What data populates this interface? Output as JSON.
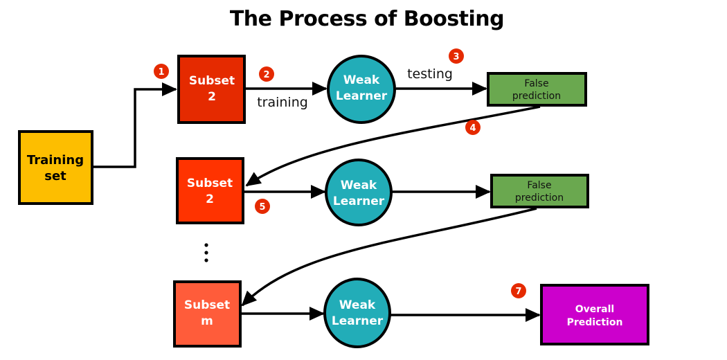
{
  "title": "The Process of Boosting",
  "colors": {
    "training_set": "#FDBE00",
    "subset_1": "#E52A00",
    "subset_2": "#FF3300",
    "subset_m": "#FF5C3A",
    "weak_learner": "#22ADB8",
    "false_prediction": "#6AA84F",
    "overall_prediction": "#CC00CC",
    "badge": "#E52A00",
    "stroke": "#000000"
  },
  "nodes": {
    "training_set": {
      "line1": "Training",
      "line2": "set"
    },
    "subset_1": {
      "line1": "Subset",
      "line2": "2"
    },
    "subset_2": {
      "line1": "Subset",
      "line2": "2"
    },
    "subset_m": {
      "line1": "Subset",
      "line2": "m"
    },
    "weak_learner_1": {
      "line1": "Weak",
      "line2": "Learner"
    },
    "weak_learner_2": {
      "line1": "Weak",
      "line2": "Learner"
    },
    "weak_learner_3": {
      "line1": "Weak",
      "line2": "Learner"
    },
    "false_prediction_1": {
      "line1": "False",
      "line2": "prediction"
    },
    "false_prediction_2": {
      "line1": "False",
      "line2": "prediction"
    },
    "overall_prediction": {
      "line1": "Overall",
      "line2": "Prediction"
    }
  },
  "edge_labels": {
    "training": "training",
    "testing": "testing"
  },
  "badges": {
    "b1": "1",
    "b2": "2",
    "b3": "3",
    "b4": "4",
    "b5": "5",
    "b7": "7"
  },
  "ellipsis": "⋮"
}
